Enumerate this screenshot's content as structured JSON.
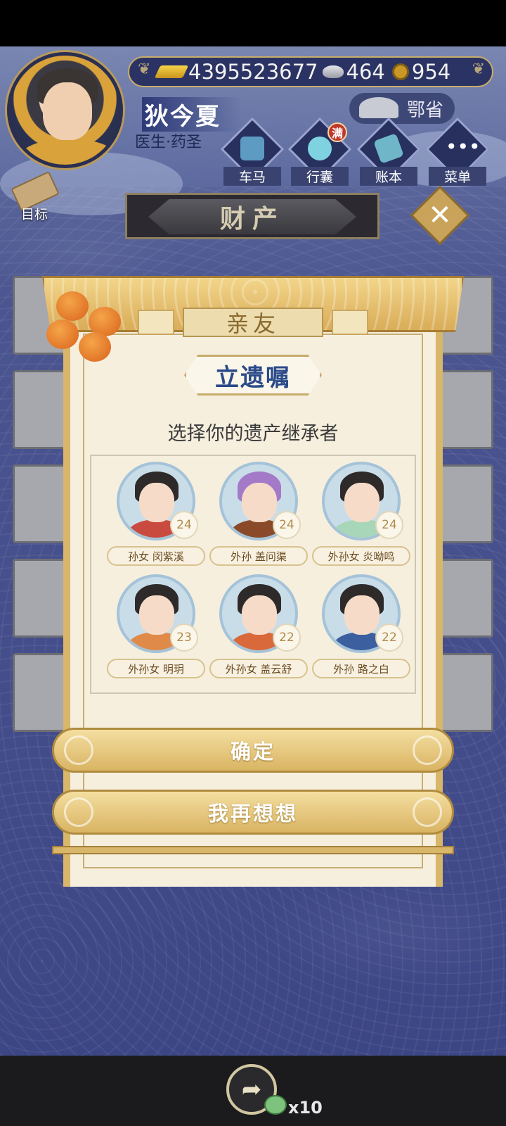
{
  "header": {
    "resources": {
      "gold": "4395523677",
      "silver": "464",
      "coins": "954"
    },
    "player_name": "狄今夏",
    "player_title": "医生·药圣",
    "region": "鄂省",
    "menu": [
      {
        "label": "车马",
        "icon": "carriage-icon"
      },
      {
        "label": "行囊",
        "icon": "bag-icon",
        "badge": "满"
      },
      {
        "label": "账本",
        "icon": "ledger-icon"
      },
      {
        "label": "菜单",
        "icon": "more-icon"
      }
    ],
    "goal_label": "目标",
    "banner_label": "财产",
    "close_icon": "✕"
  },
  "modal": {
    "tab_label": "亲友",
    "title": "立遗嘱",
    "subtitle": "选择你的遗产继承者",
    "heirs": [
      {
        "label": "孙女 闵紫溪",
        "age": "24"
      },
      {
        "label": "外孙 盖问渠",
        "age": "24"
      },
      {
        "label": "外孙女 炎呦鸣",
        "age": "24"
      },
      {
        "label": "外孙女 明玥",
        "age": "23"
      },
      {
        "label": "外孙女 盖云舒",
        "age": "22"
      },
      {
        "label": "外孙 路之白",
        "age": "22"
      }
    ],
    "confirm_label": "确定",
    "reconsider_label": "我再想想"
  },
  "bottom": {
    "share_icon": "share-icon",
    "reward_count": "x10"
  },
  "colors": {
    "accent_gold": "#d9b463",
    "background_blue": "#4b5590",
    "title_blue": "#2b4a8a"
  }
}
